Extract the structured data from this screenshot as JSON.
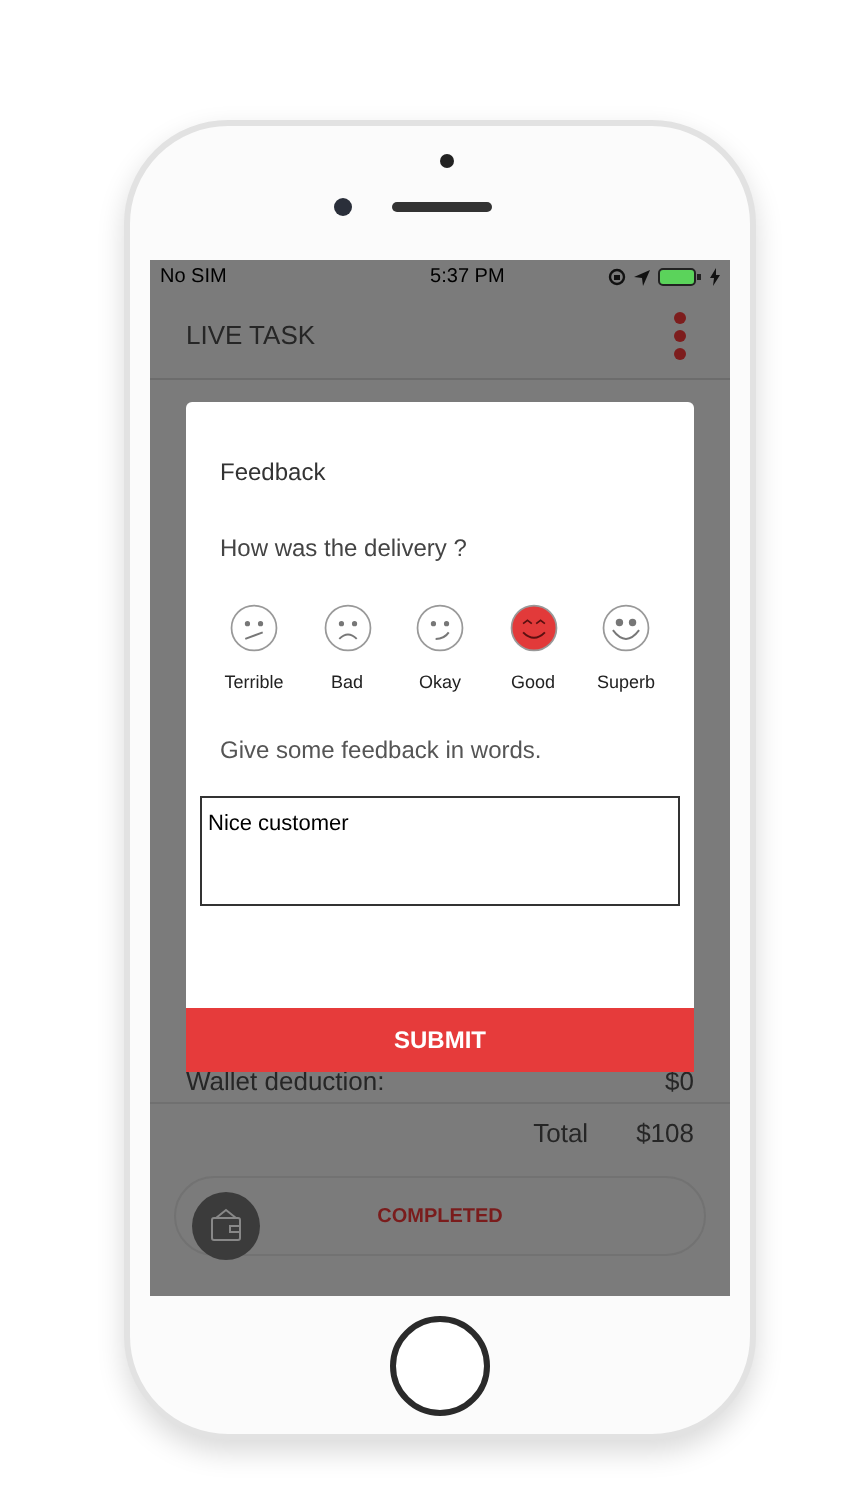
{
  "status_bar": {
    "carrier": "No SIM",
    "time": "5:37 PM"
  },
  "header": {
    "title": "LIVE TASK"
  },
  "summary": {
    "wallet_label": "Wallet deduction:",
    "wallet_value": "$0",
    "total_label": "Total",
    "total_value": "$108"
  },
  "status_button": {
    "label": "COMPLETED"
  },
  "dialog": {
    "title": "Feedback",
    "question": "How was the delivery ?",
    "ratings": [
      {
        "label": "Terrible",
        "kind": "skewed",
        "selected": false
      },
      {
        "label": "Bad",
        "kind": "frown",
        "selected": false
      },
      {
        "label": "Okay",
        "kind": "smirk",
        "selected": false
      },
      {
        "label": "Good",
        "kind": "grin",
        "selected": true
      },
      {
        "label": "Superb",
        "kind": "smile",
        "selected": false
      }
    ],
    "prompt": "Give some feedback in words.",
    "feedback": "Nice customer",
    "submit": "SUBMIT"
  }
}
